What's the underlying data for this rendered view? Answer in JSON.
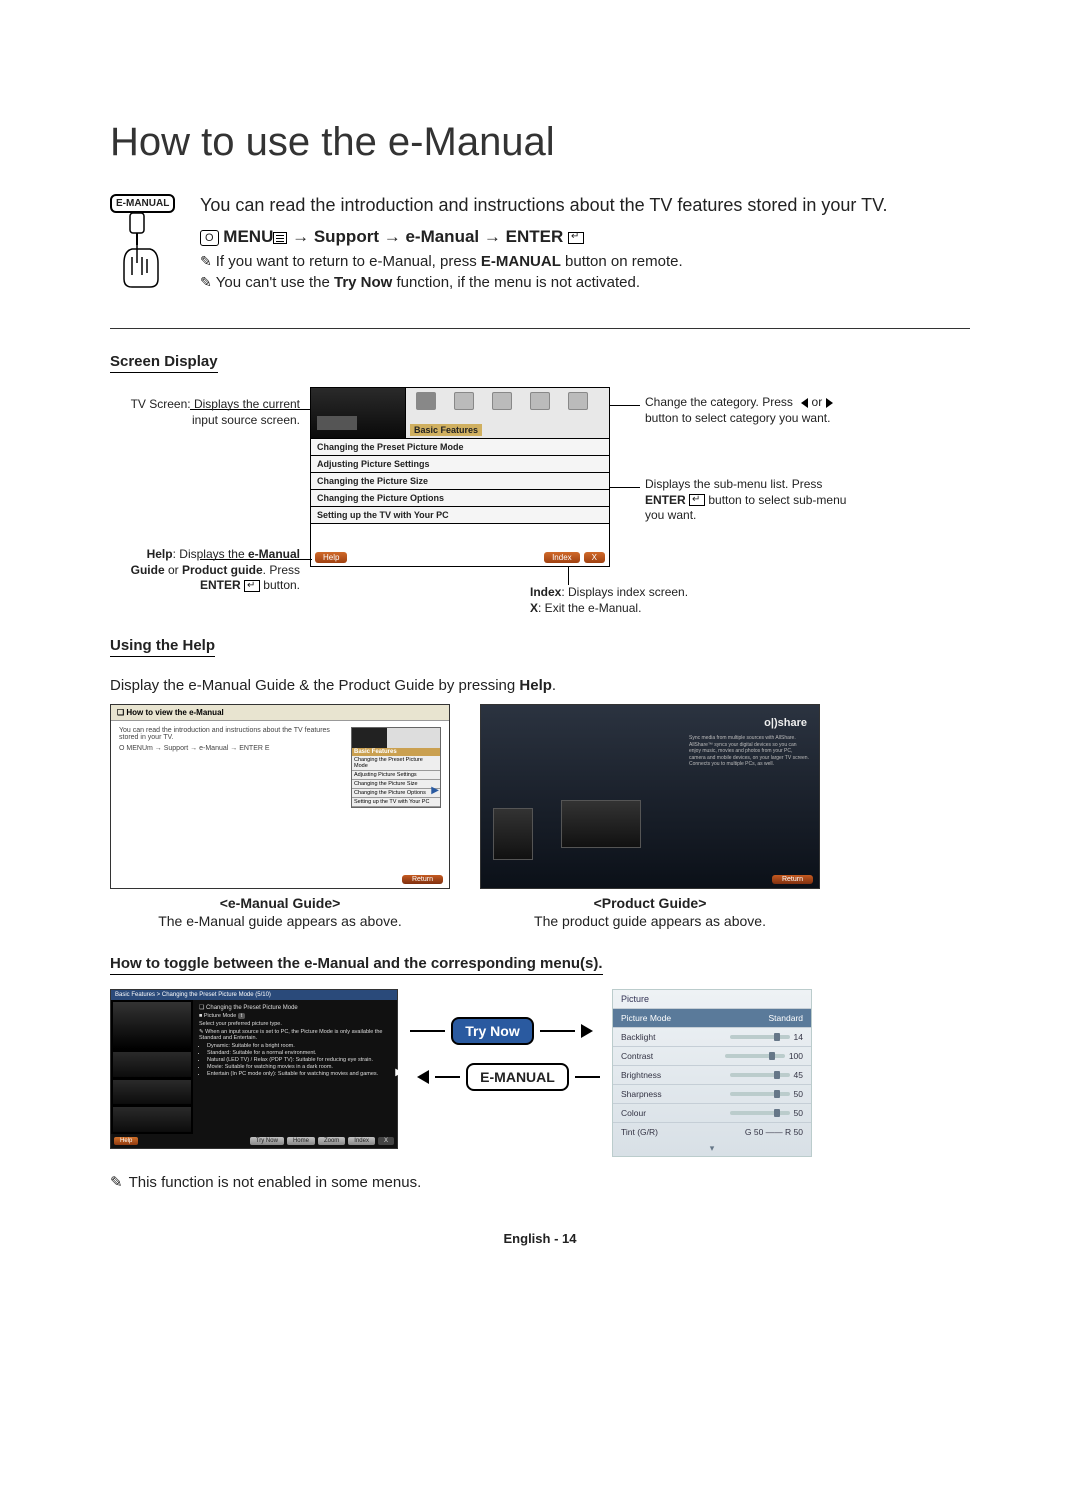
{
  "title": "How to use the e-Manual",
  "intro": {
    "badge": "E-MANUAL",
    "text": "You can read the introduction and instructions about the TV features stored in your TV.",
    "path": {
      "osd": "O",
      "menu": "MENU",
      "arrow": " → ",
      "support": "Support",
      "emanual": "e-Manual",
      "enter": "ENTER",
      "enter_sym": "E"
    },
    "note1_pre": "If you want to return to e-Manual, press ",
    "note1_b": "E-MANUAL",
    "note1_post": " button on remote.",
    "note2_pre": "You can't use the ",
    "note2_b": "Try Now",
    "note2_post": " function, if the menu is not activated."
  },
  "screen_display": {
    "heading": "Screen Display",
    "category_label": "Basic Features",
    "items": [
      "Changing the Preset Picture Mode",
      "Adjusting Picture Settings",
      "Changing the Picture Size",
      "Changing the Picture Options",
      "Setting up the TV with Your PC"
    ],
    "help_btn": "Help",
    "index_btn": "Index",
    "x_btn": "X",
    "callouts": {
      "tv": "TV Screen: Displays the current input source screen.",
      "help_a": "Help",
      "help_b": ": Displays the ",
      "help_c": "e-Manual Guide",
      "help_d": " or ",
      "help_e": "Product guide",
      "help_f": ". Press ",
      "help_g": "ENTER",
      "help_h": " button.",
      "cat": "Change the category. Press ◀ or ▶ button to select category you want.",
      "sub_a": "Displays the sub-menu list. Press ",
      "sub_b": "ENTER",
      "sub_c": " button to select sub-menu you want.",
      "idx_a": "Index",
      "idx_b": ": Displays index screen.",
      "x_a": "X",
      "x_b": ": Exit the e-Manual."
    }
  },
  "using_help": {
    "heading": "Using the Help",
    "intro_pre": "Display the e-Manual Guide & the Product Guide by pressing ",
    "intro_b": "Help",
    "intro_post": ".",
    "left": {
      "box_title": "❏ How to view the e-Manual",
      "line1": "You can read the introduction and instructions about the TV features stored in your TV.",
      "path": "O MENUm → Support → e-Manual → ENTER E",
      "mini_cat": "Basic Features",
      "mini_items": [
        "Changing the Preset Picture Mode",
        "Adjusting Picture Settings",
        "Changing the Picture Size",
        "Changing the Picture Options",
        "Setting up the TV with Your PC"
      ],
      "return": "Return",
      "caption_title": "<e-Manual Guide>",
      "caption_sub": "The e-Manual guide appears as above."
    },
    "right": {
      "allshare": "o|)share",
      "blurb": "Sync media from multiple sources with AllShare. AllShare™ syncs your digital devices so you can enjoy music, movies and photos from your PC, camera and mobile devices, on your larger TV screen. Connects you to multiple PCs, as well.",
      "return": "Return",
      "caption_title": "<Product Guide>",
      "caption_sub": "The product guide appears as above."
    }
  },
  "toggle": {
    "heading": "How to toggle between the e-Manual and the corresponding menu(s).",
    "left": {
      "crumb": "Basic Features > Changing the Preset Picture Mode (5/10)",
      "title": "❏ Changing the Preset Picture Mode",
      "sub_a": "■ Picture Mode ",
      "sub_b": "t",
      "desc": "Select your preferred picture type.",
      "note_pre": "When an input source is set to PC, the Picture Mode is only available the Standard and Entertain.",
      "bullets": [
        "Dynamic: Suitable for a bright room.",
        "Standard: Suitable for a normal environment.",
        "Natural (LED TV) / Relax (PDP TV): Suitable for reducing eye strain.",
        "Movie: Suitable for watching movies in a dark room.",
        "Entertain (In PC mode only): Suitable for watching movies and games."
      ],
      "btn_help": "Help",
      "btn_try": "Try Now",
      "btn_home": "Home",
      "btn_zoom": "Zoom",
      "btn_index": "Index",
      "btn_x": "X"
    },
    "pill_try": "Try Now",
    "pill_em": "E-MANUAL",
    "right": {
      "head": "Picture",
      "rows": [
        {
          "label": "Picture Mode",
          "value": "Standard",
          "sel": true
        },
        {
          "label": "Backlight",
          "value": "14"
        },
        {
          "label": "Contrast",
          "value": "100"
        },
        {
          "label": "Brightness",
          "value": "45"
        },
        {
          "label": "Sharpness",
          "value": "50"
        },
        {
          "label": "Colour",
          "value": "50"
        },
        {
          "label": "Tint (G/R)",
          "value": "G 50 —— R 50",
          "noslider": true
        }
      ]
    },
    "final_note": "This function is not enabled in some menus."
  },
  "footer": "English - 14"
}
